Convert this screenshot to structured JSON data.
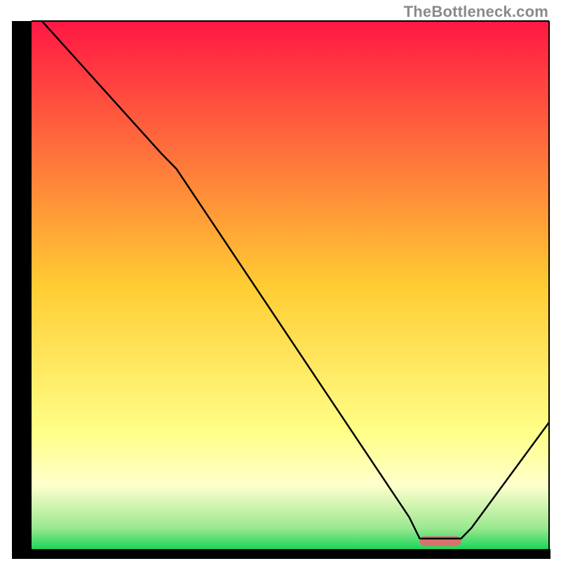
{
  "watermark": "TheBottleneck.com",
  "chart_data": {
    "type": "line",
    "title": "",
    "xlabel": "",
    "ylabel": "",
    "xlim": [
      0,
      100
    ],
    "ylim": [
      0,
      100
    ],
    "x": [
      2,
      25,
      28,
      73,
      75,
      83,
      85,
      100
    ],
    "values": [
      100,
      75,
      72,
      6,
      2,
      2,
      4,
      24
    ],
    "annotations": [],
    "grid": false,
    "optimum_band": {
      "x_start": 75,
      "x_end": 83,
      "color": "#d9726b"
    },
    "background_gradient": [
      {
        "pos": 0.0,
        "color": "#ff1744"
      },
      {
        "pos": 0.5,
        "color": "#ffcc33"
      },
      {
        "pos": 0.78,
        "color": "#ffff88"
      },
      {
        "pos": 0.88,
        "color": "#ffffcc"
      },
      {
        "pos": 0.96,
        "color": "#9be890"
      },
      {
        "pos": 1.0,
        "color": "#1bd659"
      }
    ]
  }
}
